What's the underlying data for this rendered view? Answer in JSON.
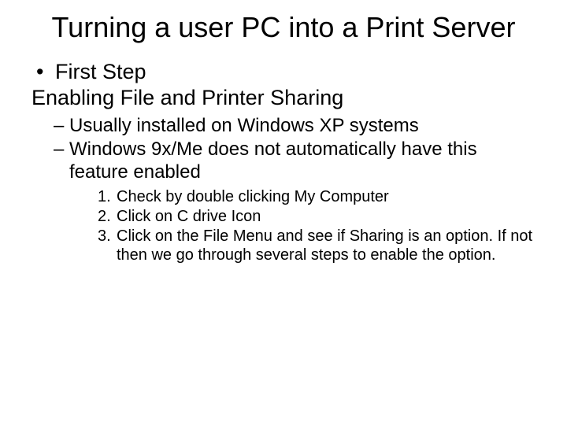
{
  "slide": {
    "title": "Turning a user PC into a Print Server",
    "bullet1_marker": "•",
    "bullet1_text": "First Step",
    "line2": "Enabling File and Printer Sharing",
    "sub": [
      {
        "marker": "–",
        "text": "Usually installed on Windows XP systems"
      },
      {
        "marker": "–",
        "text": "Windows 9x/Me does not automatically have this feature enabled"
      }
    ],
    "steps": [
      {
        "marker": "1.",
        "text": "Check by double clicking My Computer"
      },
      {
        "marker": "2.",
        "text": "Click on C drive Icon"
      },
      {
        "marker": "3.",
        "text": "Click on the File Menu and see if Sharing is an option.  If not then we go through several steps to enable the option."
      }
    ]
  }
}
